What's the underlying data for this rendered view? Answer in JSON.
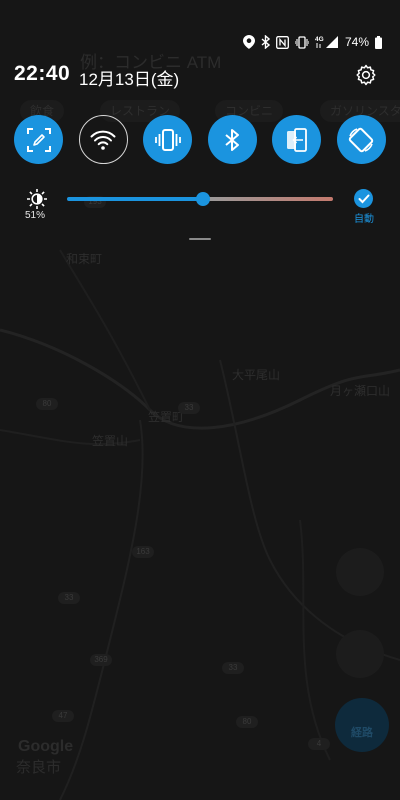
{
  "map": {
    "search_hint": "例：コンビニ ATM",
    "chips": [
      "飲食",
      "レストラン",
      "コンビニ",
      "ガソリンスタンド"
    ],
    "labels": {
      "town_north": "和束町",
      "mountain_main": "大平尾山",
      "mountain_east": "月ヶ瀬口山",
      "town_center": "笠置町",
      "mountain_south": "笠置山"
    },
    "road_badges": [
      "80",
      "163",
      "33",
      "369",
      "47",
      "80",
      "4",
      "33",
      "193",
      "33"
    ],
    "directions_label": "経路",
    "google_logo": "Google",
    "city": "奈良市"
  },
  "status_bar": {
    "icons": [
      "location-icon",
      "bluetooth-icon",
      "nfc-icon",
      "vibrate-icon",
      "4g-signal-icon",
      "battery-icon"
    ],
    "network_label": "4G",
    "battery_percent": "74%"
  },
  "header": {
    "time": "22:40",
    "date": "12月13日(金)"
  },
  "quick_toggles": [
    {
      "name": "screen-capture",
      "active": true
    },
    {
      "name": "wifi",
      "active": false
    },
    {
      "name": "vibrate",
      "active": true
    },
    {
      "name": "bluetooth",
      "active": true
    },
    {
      "name": "screen-share",
      "active": true
    },
    {
      "name": "auto-rotate",
      "active": true
    }
  ],
  "brightness": {
    "percent_label": "51%",
    "level": 0.51,
    "auto_label": "自動",
    "auto_enabled": true
  },
  "colors": {
    "accent": "#1b94df",
    "scrim": "#141414"
  }
}
